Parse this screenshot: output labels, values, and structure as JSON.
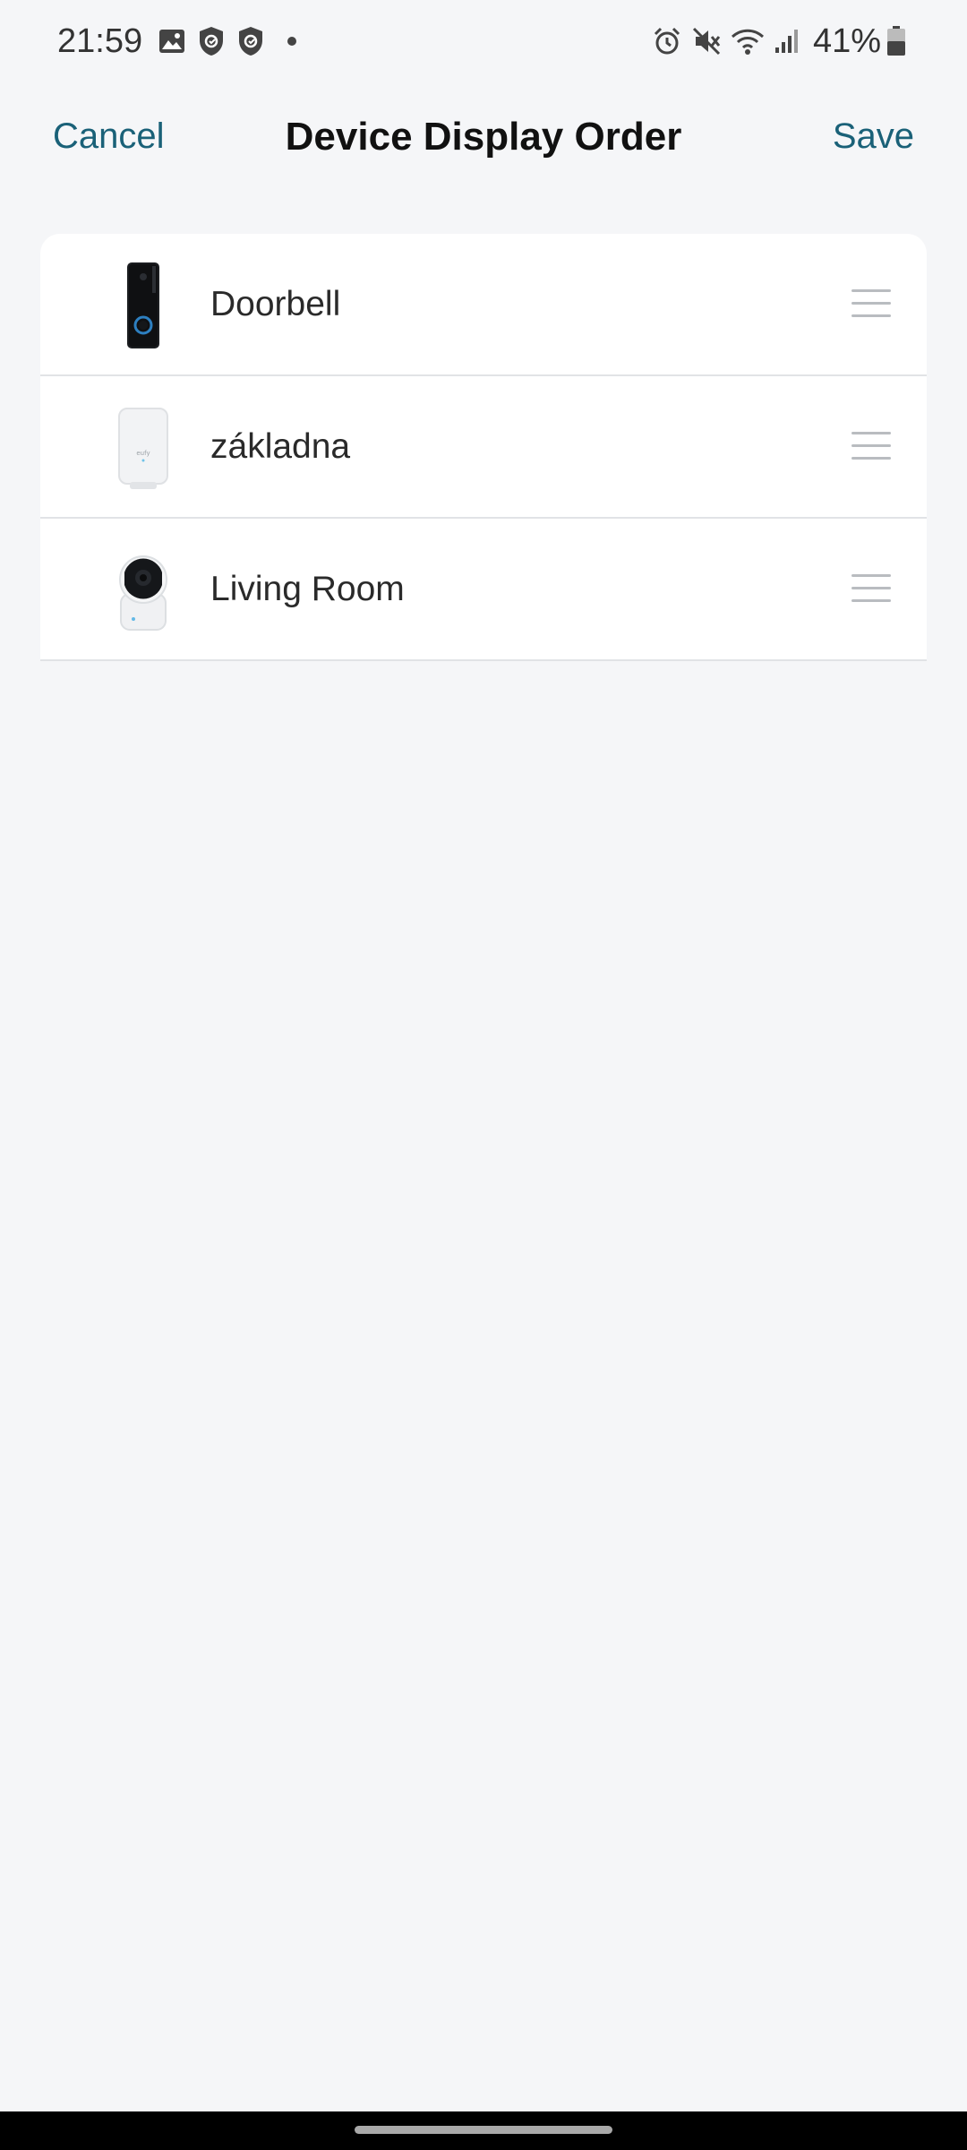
{
  "status_bar": {
    "time": "21:59",
    "battery_text": "41%",
    "icons_left": [
      "gallery-icon",
      "shield-check-icon",
      "shield-check-icon",
      "notification-dot-icon"
    ],
    "icons_right": [
      "alarm-icon",
      "mute-icon",
      "wifi-icon",
      "signal-icon",
      "battery-icon"
    ]
  },
  "header": {
    "cancel_label": "Cancel",
    "title": "Device Display Order",
    "save_label": "Save"
  },
  "devices": [
    {
      "label": "Doorbell",
      "icon": "doorbell-device-image"
    },
    {
      "label": "základna",
      "icon": "homebase-device-image"
    },
    {
      "label": "Living Room",
      "icon": "indoor-camera-device-image"
    }
  ],
  "colors": {
    "accent": "#1a6178",
    "background": "#f5f6f8",
    "card": "#ffffff",
    "handle": "#b9bcc0"
  }
}
